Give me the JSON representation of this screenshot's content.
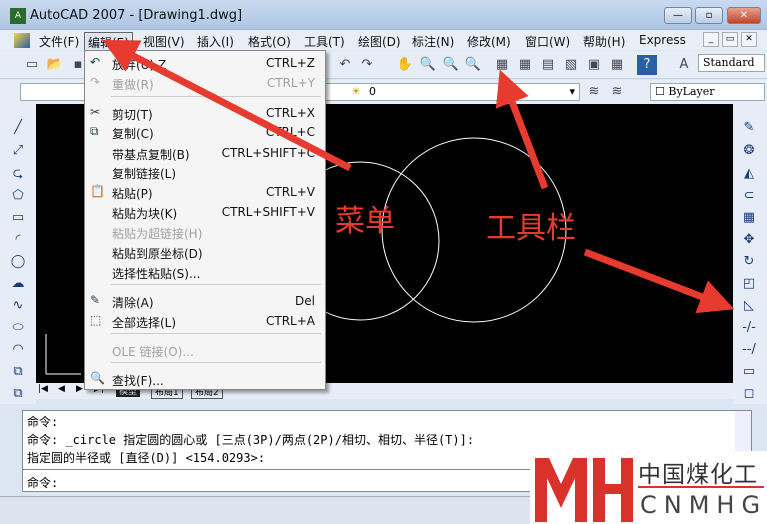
{
  "window": {
    "title": "AutoCAD 2007 - [Drawing1.dwg]",
    "icon": "autocad-icon",
    "controls": [
      "minimize",
      "maximize",
      "close"
    ]
  },
  "menubar": [
    {
      "label": "文件(F)"
    },
    {
      "label": "编辑(E)"
    },
    {
      "label": "视图(V)"
    },
    {
      "label": "插入(I)"
    },
    {
      "label": "格式(O)"
    },
    {
      "label": "工具(T)"
    },
    {
      "label": "绘图(D)"
    },
    {
      "label": "标注(N)"
    },
    {
      "label": "修改(M)"
    },
    {
      "label": "窗口(W)"
    },
    {
      "label": "帮助(H)"
    },
    {
      "label": "Express"
    }
  ],
  "toolbar": {
    "text_style": "Standard",
    "layer": "0",
    "color": "ByLayer"
  },
  "edit_menu": [
    {
      "label": "放弃(U) Z",
      "shortcut": "CTRL+Z",
      "icon": "undo-icon",
      "enabled": true
    },
    {
      "label": "重做(R)",
      "shortcut": "CTRL+Y",
      "icon": "redo-icon",
      "enabled": false
    },
    {
      "label": "剪切(T)",
      "shortcut": "CTRL+X",
      "icon": "scissors-icon",
      "enabled": true
    },
    {
      "label": "复制(C)",
      "shortcut": "CTRL+C",
      "icon": "copy-icon",
      "enabled": true
    },
    {
      "label": "带基点复制(B)",
      "shortcut": "CTRL+SHIFT+C",
      "icon": "",
      "enabled": true
    },
    {
      "label": "复制链接(L)",
      "shortcut": "",
      "icon": "",
      "enabled": true
    },
    {
      "label": "粘贴(P)",
      "shortcut": "CTRL+V",
      "icon": "paste-icon",
      "enabled": true
    },
    {
      "label": "粘贴为块(K)",
      "shortcut": "CTRL+SHIFT+V",
      "icon": "",
      "enabled": true
    },
    {
      "label": "粘贴为超链接(H)",
      "shortcut": "",
      "icon": "",
      "enabled": false
    },
    {
      "label": "粘贴到原坐标(D)",
      "shortcut": "",
      "icon": "",
      "enabled": true
    },
    {
      "label": "选择性粘贴(S)...",
      "shortcut": "",
      "icon": "",
      "enabled": true
    },
    {
      "label": "清除(A)",
      "shortcut": "Del",
      "icon": "eraser-icon",
      "enabled": true
    },
    {
      "label": "全部选择(L)",
      "shortcut": "CTRL+A",
      "icon": "select-all-icon",
      "enabled": true
    },
    {
      "label": "OLE 链接(O)...",
      "shortcut": "",
      "icon": "",
      "enabled": false
    },
    {
      "label": "查找(F)...",
      "shortcut": "",
      "icon": "find-icon",
      "enabled": true
    }
  ],
  "layout_tabs": [
    "模型",
    "布局1",
    "布局2"
  ],
  "command": {
    "lines": [
      "命令:",
      "命令: _circle 指定圆的圆心或 [三点(3P)/两点(2P)/相切、相切、半径(T)]:",
      "指定圆的半径或 [直径(D)] <154.0293>:"
    ],
    "prompt": "命令:"
  },
  "annotations": {
    "menu": "菜单",
    "toolbar": "工具栏",
    "color": "#e63b2e"
  },
  "watermark": {
    "logo": "MH",
    "cn": "中国煤化工",
    "en": "CNMHG"
  }
}
